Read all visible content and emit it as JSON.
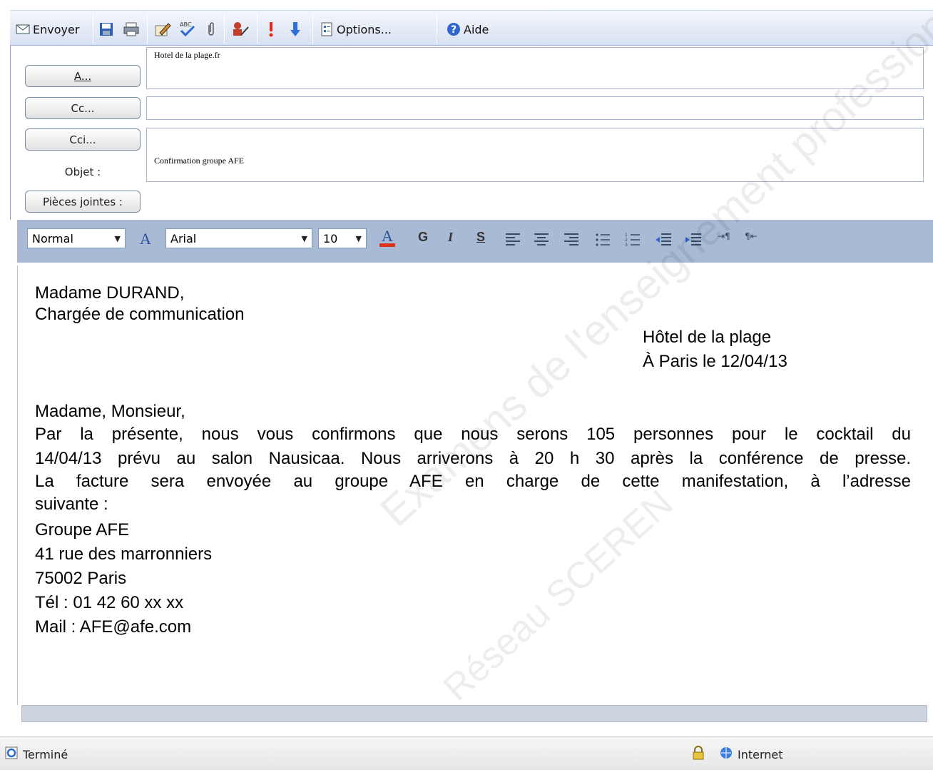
{
  "toolbar": {
    "send_label": "Envoyer",
    "options_label": "Options...",
    "help_label": "Aide"
  },
  "address": {
    "to_button": "A...",
    "cc_button": "Cc...",
    "bcc_button": "Cci...",
    "subject_label": "Objet :",
    "attachments_button": "Pièces jointes :",
    "to_value": "Hotel de la plage.fr",
    "cc_value": "",
    "bcc_value": "",
    "subject_value": "Confirmation groupe AFE"
  },
  "format": {
    "style": "Normal",
    "font": "Arial",
    "size": "10",
    "bold": "G",
    "italic": "I",
    "underline": "S"
  },
  "letter": {
    "recipient_name": "Madame DURAND,",
    "recipient_role": "Chargée de communication",
    "sender": "Hôtel de la plage",
    "place_date": "À Paris le 12/04/13",
    "salutation": "Madame, Monsieur,",
    "p1_line1": "Par la présente, nous vous confirmons que nous serons 105 personnes pour le cocktail du",
    "p1_line2": "14/04/13 prévu au salon Nausicaa. Nous arriverons à 20 h 30 après la conférence de presse.",
    "p1_line3": "La facture sera envoyée au groupe AFE en charge de cette manifestation, à l’adresse",
    "p1_line4": "suivante :",
    "addr1": "Groupe AFE",
    "addr2": "41 rue des marronniers",
    "addr3": "75002 Paris",
    "phone": "Tél : 01 42 60 xx xx",
    "mail": "Mail : AFE@afe.com"
  },
  "status": {
    "left": "Terminé",
    "zone": "Internet"
  },
  "watermark": {
    "line1": "Examens de l'enseignement professionnel",
    "line2": "Réseau SCEREN"
  },
  "colors": {
    "toolbar_bg": "#dbe4f3",
    "format_bar_bg": "#a9bad4",
    "accent_red": "#d9341e"
  }
}
